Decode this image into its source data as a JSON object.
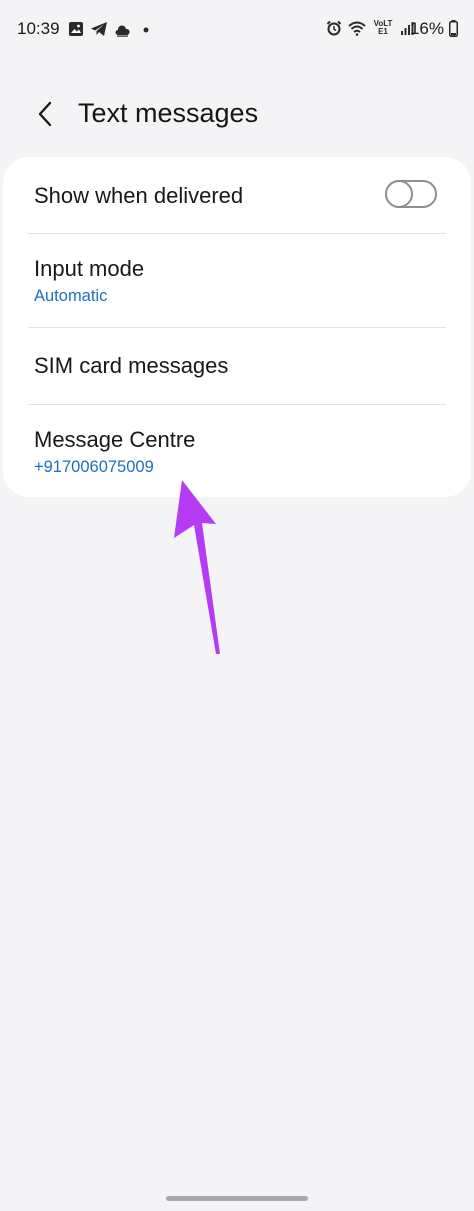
{
  "status_bar": {
    "time": "10:39",
    "battery": "16%",
    "network_label": "VoLTE1",
    "left_icons": [
      "gallery-icon",
      "telegram-icon",
      "weather-icon",
      "dot-icon"
    ],
    "right_icons": [
      "alarm-icon",
      "wifi-icon",
      "volte-icon",
      "signal-icon",
      "battery-icon"
    ]
  },
  "header": {
    "title": "Text messages",
    "back_icon": "chevron-left-icon"
  },
  "settings": {
    "items": [
      {
        "title": "Show when delivered",
        "toggle_on": false
      },
      {
        "title": "Input mode",
        "subtitle": "Automatic"
      },
      {
        "title": "SIM card messages"
      },
      {
        "title": "Message Centre",
        "subtitle": "+917006075009"
      }
    ]
  },
  "colors": {
    "background": "#f4f3f6",
    "card": "#ffffff",
    "accent_text": "#1c6fc4",
    "annotation_arrow": "#b43cf5"
  }
}
